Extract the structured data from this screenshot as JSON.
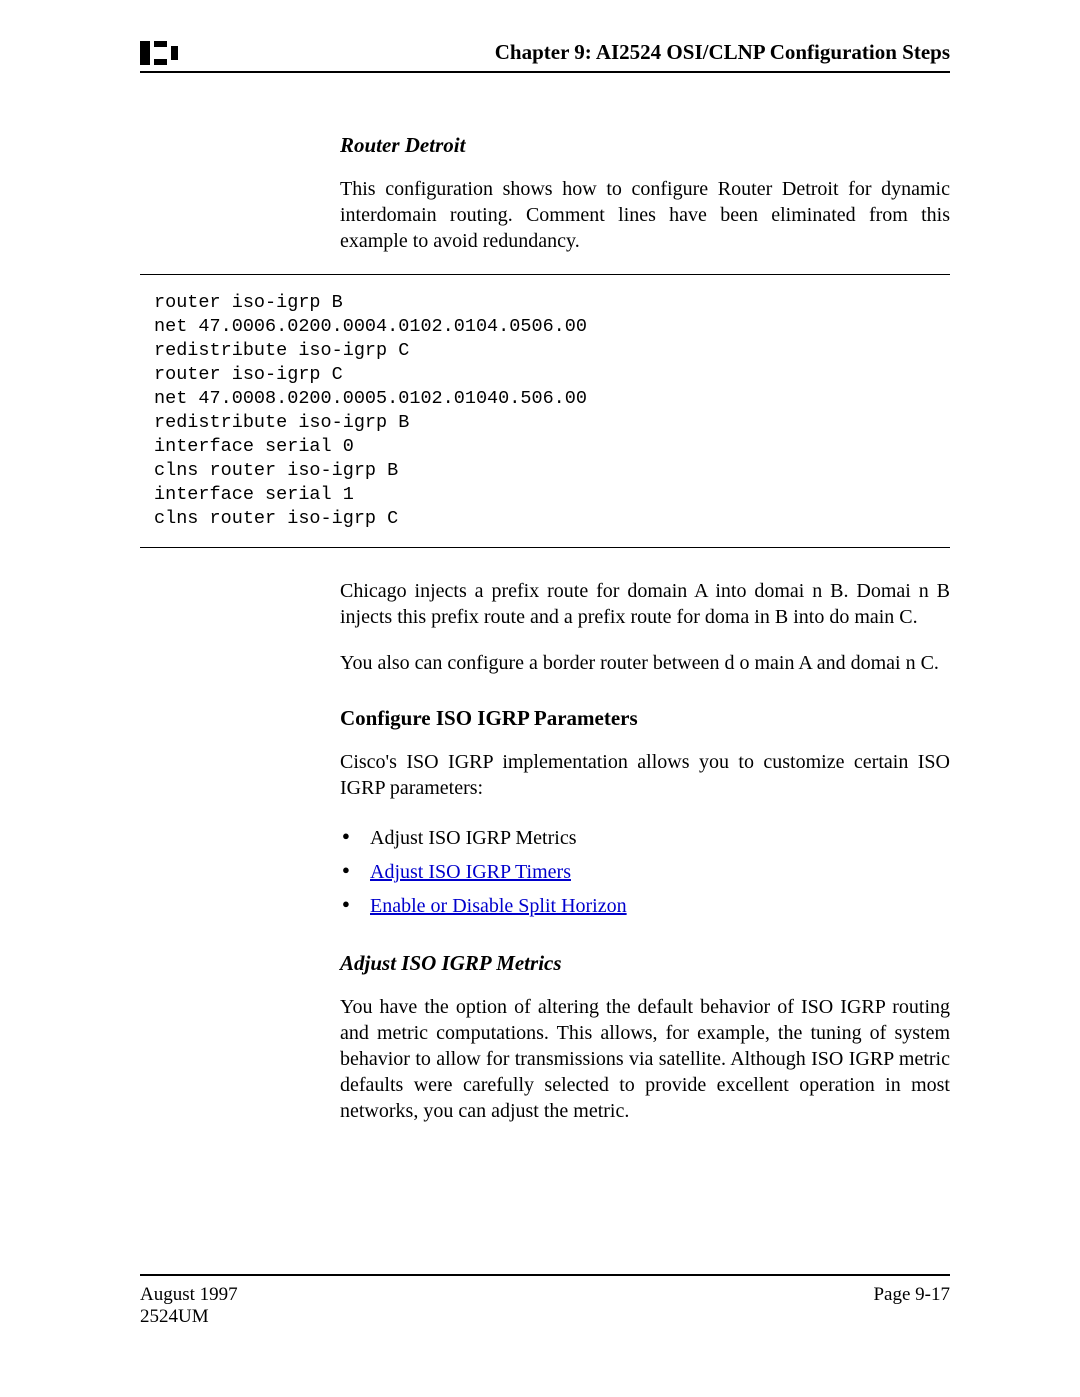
{
  "header": {
    "chapter_title": "Chapter 9: AI2524 OSI/CLNP Configuration Steps"
  },
  "section1": {
    "heading": "Router Detroit",
    "para": "This configuration shows how to configure Router Detroit for dynamic interdomain routing. Comment lines have been eliminated from this example to avoid redundancy."
  },
  "code": "router iso-igrp B\nnet 47.0006.0200.0004.0102.0104.0506.00\nredistribute iso-igrp C\nrouter iso-igrp C\nnet 47.0008.0200.0005.0102.01040.506.00\nredistribute iso-igrp B\ninterface serial 0\nclns router iso-igrp B\ninterface serial 1\nclns router iso-igrp C",
  "after_code": {
    "para1": "Chicago injects a prefix route for domain A  into domai n B. Domai n B injects this prefix route and a prefix route for doma in B into do main C.",
    "para2": "You also can configure a border router between d o main A and domai n C."
  },
  "section2": {
    "heading": "Configure ISO IGRP Parameters",
    "intro": "Cisco's ISO IGRP implementation allows you to customize certain ISO IGRP parameters:",
    "bullets": {
      "b1": "Adjust ISO IGRP Metrics",
      "b2": "Adjust ISO IGRP Timers",
      "b3": "Enable or Disable Split Horizon"
    }
  },
  "section3": {
    "heading": "Adjust ISO IGRP Metrics",
    "para": "You have the option of altering the default behavior of ISO IGRP routing and metric computations. This allows, for example, the tuning of system behavior to allow for transmissions via satellite. Although ISO IGRP metric defaults were carefully selected to provide excellent operation in most networks, you can adjust the metric."
  },
  "footer": {
    "date": "August 1997",
    "doc_id": "2524UM",
    "page": "Page 9-17"
  }
}
